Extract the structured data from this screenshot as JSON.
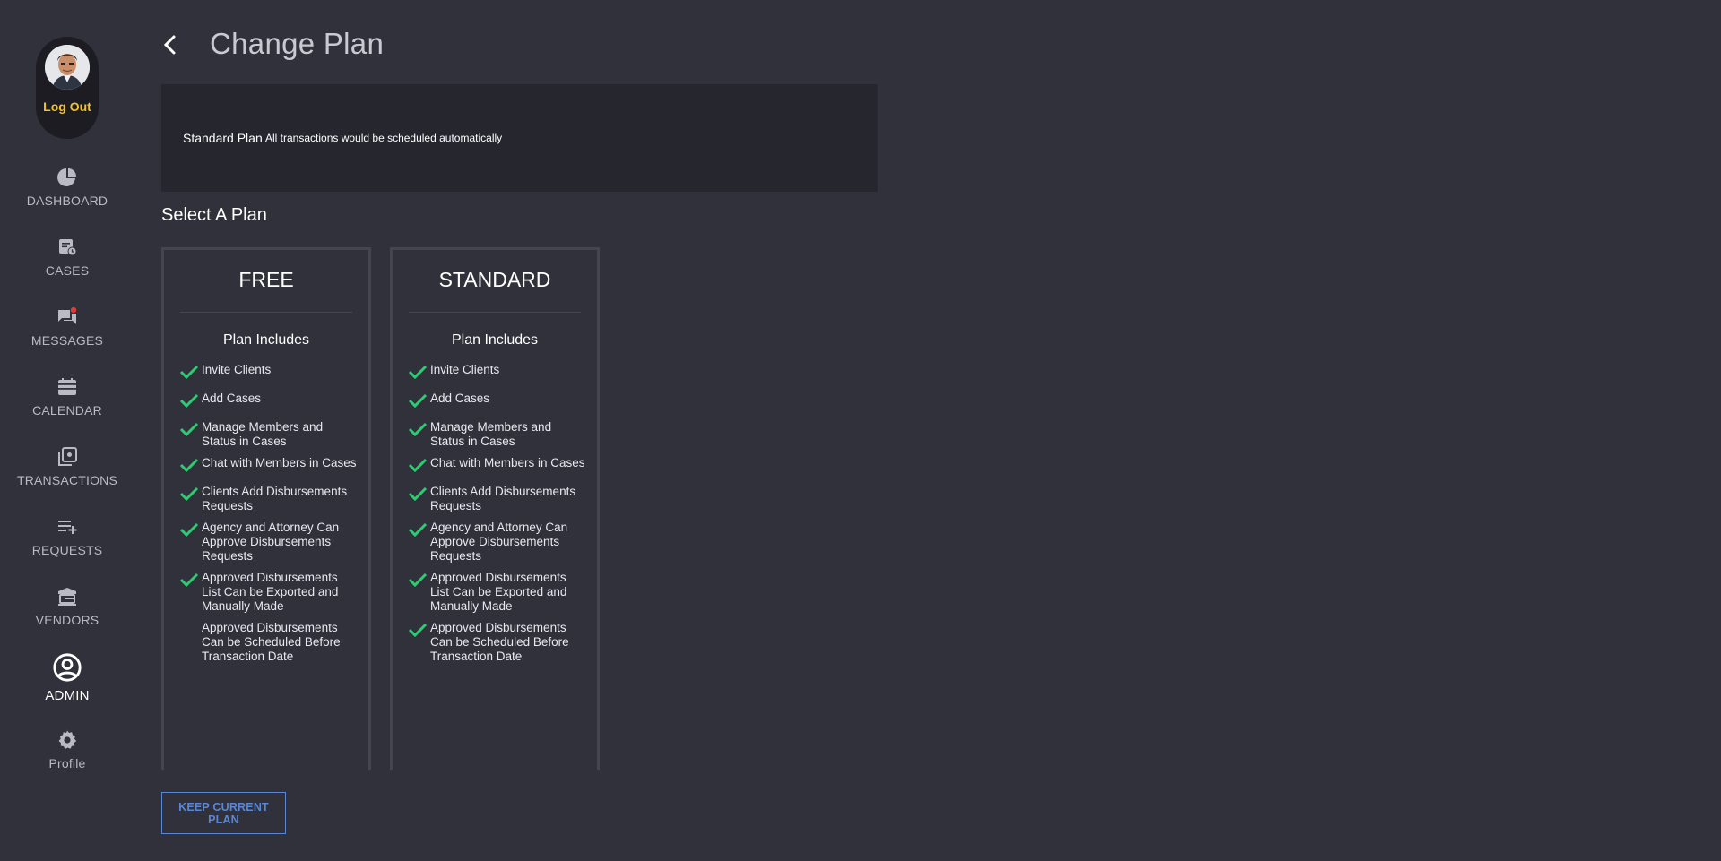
{
  "sidebar": {
    "logout_label": "Log Out",
    "items": [
      {
        "label": "DASHBOARD",
        "icon": "pie-chart-icon"
      },
      {
        "label": "CASES",
        "icon": "cases-icon"
      },
      {
        "label": "MESSAGES",
        "icon": "chat-icon"
      },
      {
        "label": "CALENDAR",
        "icon": "calendar-icon"
      },
      {
        "label": "TRANSACTIONS",
        "icon": "transactions-icon"
      },
      {
        "label": "REQUESTS",
        "icon": "playlist-add-icon"
      },
      {
        "label": "VENDORS",
        "icon": "vendors-icon"
      },
      {
        "label": "ADMIN",
        "icon": "account-circle-icon"
      },
      {
        "label": "Profile",
        "icon": "gear-icon"
      }
    ],
    "active": "ADMIN"
  },
  "header": {
    "title": "Change Plan"
  },
  "current_plan": {
    "name": "Standard Plan",
    "description": "All transactions would be scheduled automatically"
  },
  "select_heading": "Select A Plan",
  "plans": [
    {
      "name": "FREE",
      "includes_label": "Plan Includes",
      "features": [
        {
          "text": "Invite Clients",
          "included": true
        },
        {
          "text": "Add Cases",
          "included": true
        },
        {
          "text": "Manage Members and Status in Cases",
          "included": true
        },
        {
          "text": "Chat with Members in Cases",
          "included": true
        },
        {
          "text": "Clients Add Disbursements Requests",
          "included": true
        },
        {
          "text": "Agency and Attorney Can Approve Disbursements Requests",
          "included": true
        },
        {
          "text": "Approved Disbursements List Can be Exported and Manually Made",
          "included": true
        },
        {
          "text": "Approved Disbursements Can be Scheduled Before Transaction Date",
          "included": false
        }
      ]
    },
    {
      "name": "STANDARD",
      "includes_label": "Plan Includes",
      "features": [
        {
          "text": "Invite Clients",
          "included": true
        },
        {
          "text": "Add Cases",
          "included": true
        },
        {
          "text": "Manage Members and Status in Cases",
          "included": true
        },
        {
          "text": "Chat with Members in Cases",
          "included": true
        },
        {
          "text": "Clients Add Disbursements Requests",
          "included": true
        },
        {
          "text": "Agency and Attorney Can Approve Disbursements Requests",
          "included": true
        },
        {
          "text": "Approved Disbursements List Can be Exported and Manually Made",
          "included": true
        },
        {
          "text": "Approved Disbursements Can be Scheduled Before Transaction Date",
          "included": true
        }
      ]
    }
  ],
  "keep_button_label": "KEEP CURRENT PLAN",
  "colors": {
    "background": "#30313b",
    "panel": "#26262e",
    "accent": "#f2c12e",
    "check": "#2ecc71",
    "button": "#5a86d4"
  }
}
